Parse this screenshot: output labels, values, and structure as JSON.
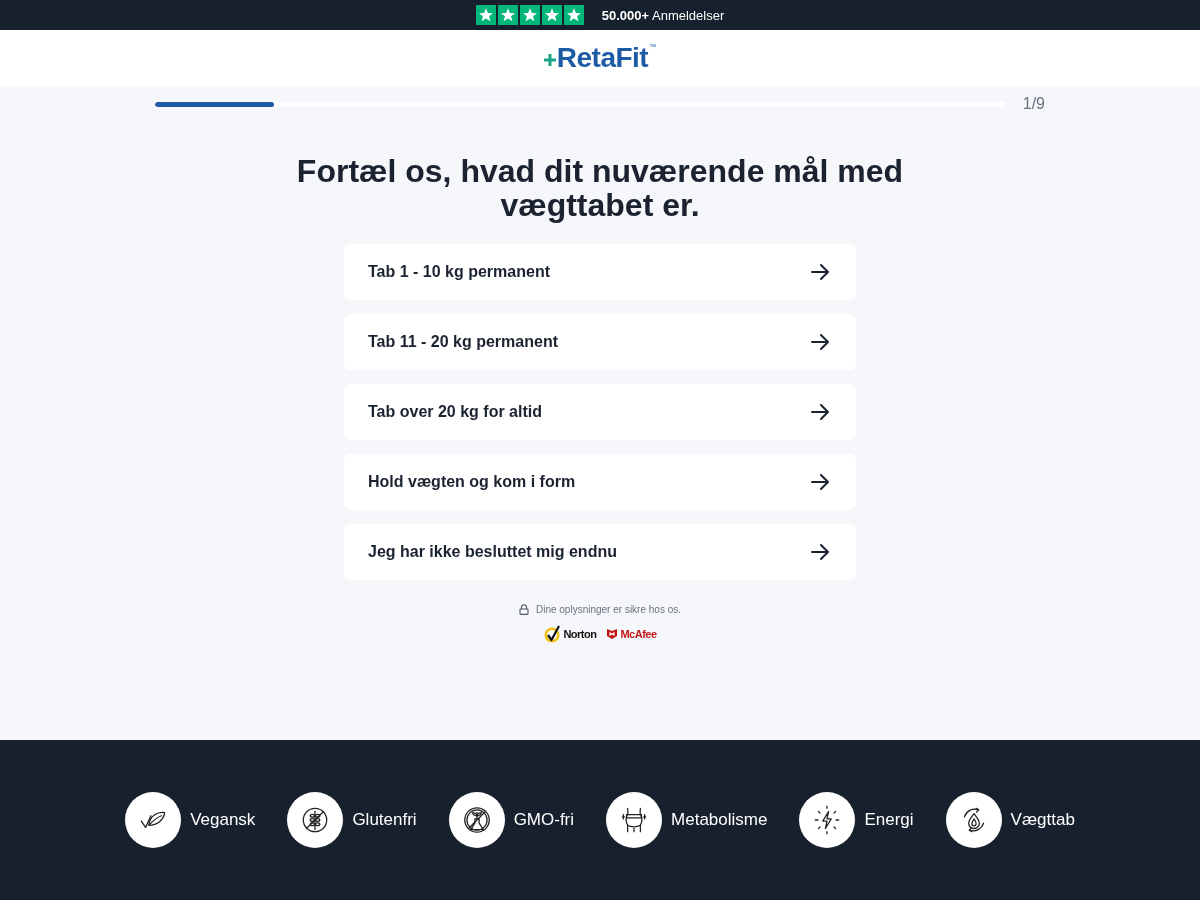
{
  "review_bar": {
    "stars": 5,
    "text": "**50.000+** Anmeldelser"
  },
  "header": {
    "logo": "RetaFit",
    "trademark": "™"
  },
  "progress": {
    "level": 0.14,
    "step": "1/9"
  },
  "question": {
    "title": "Fortæl os, hvad dit nuværende mål med vægttabet er.",
    "options": [
      {
        "label": "Tab 1 - 10 kg permanent"
      },
      {
        "label": "Tab 11 - 20 kg permanent"
      },
      {
        "label": "Tab over 20 kg for altid"
      },
      {
        "label": "Hold vægten og kom i form"
      },
      {
        "label": "Jeg har ikke besluttet mig endnu"
      }
    ]
  },
  "security": {
    "note": "Dine oplysninger er sikre hos os.",
    "badges": [
      {
        "kind": "norton",
        "text": "Norton"
      },
      {
        "kind": "mcafee",
        "text": "McAfee"
      }
    ]
  },
  "features": [
    {
      "kind": "vegan",
      "label": "Vegansk"
    },
    {
      "kind": "gluten_free",
      "label": "Glutenfri"
    },
    {
      "kind": "gmo_free",
      "label": "GMO-fri"
    },
    {
      "kind": "metabolism",
      "label": "Metabolisme"
    },
    {
      "kind": "energy",
      "label": "Energi"
    },
    {
      "kind": "weight_loss",
      "label": "Vægttab"
    }
  ]
}
